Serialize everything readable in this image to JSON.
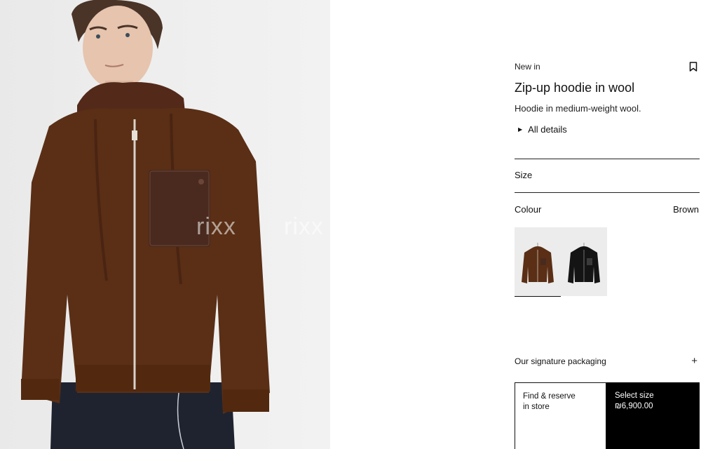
{
  "image": {
    "watermark_text": "rixx",
    "garment_color": "#5a2f16",
    "pocket_color": "#4a2a1f",
    "background_color": "#ececec"
  },
  "product": {
    "badge": "New in",
    "title": "Zip-up hoodie in wool",
    "description": "Hoodie in medium-weight wool.",
    "details_label": "All details",
    "details_icon": "triangle-right-icon",
    "bookmark_icon": "bookmark-icon"
  },
  "size": {
    "label": "Size"
  },
  "colour": {
    "label": "Colour",
    "selected": "Brown",
    "options": [
      {
        "color": "#5a2f16",
        "pocket": "#4a2a1f",
        "selected": true
      },
      {
        "color": "#141414",
        "pocket": "#3a3a3a",
        "selected": false
      }
    ]
  },
  "packaging": {
    "label": "Our signature packaging",
    "icon": "plus-icon"
  },
  "actions": {
    "find_line1": "Find & reserve",
    "find_line2": "in store",
    "select_line1": "Select size",
    "price": "₪6,900.00"
  }
}
